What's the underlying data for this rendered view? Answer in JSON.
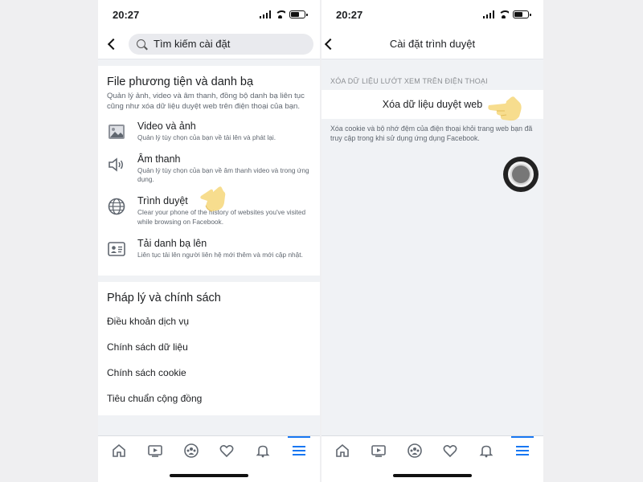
{
  "status": {
    "time": "20:27"
  },
  "left": {
    "search": {
      "placeholder": "Tìm kiếm cài đặt"
    },
    "media_section": {
      "title": "File phương tiện và danh bạ",
      "description": "Quản lý ảnh, video và âm thanh, đồng bộ danh bạ liên tục cũng như xóa dữ liệu duyệt web trên điện thoại của bạn.",
      "items": [
        {
          "title": "Video và ảnh",
          "desc": "Quản lý tùy chọn của bạn về tải lên và phát lại.",
          "icon": "photo-icon"
        },
        {
          "title": "Âm thanh",
          "desc": "Quản lý tùy chọn của bạn về âm thanh video và trong ứng dụng.",
          "icon": "speaker-icon"
        },
        {
          "title": "Trình duyệt",
          "desc": "Clear your phone of the history of websites you've visited while browsing on Facebook.",
          "icon": "globe-icon"
        },
        {
          "title": "Tải danh bạ lên",
          "desc": "Liên tục tải lên người liên hệ mới thêm và mới cập nhật.",
          "icon": "contact-card-icon"
        }
      ]
    },
    "legal_section": {
      "title": "Pháp lý và chính sách",
      "links": [
        "Điều khoản dịch vụ",
        "Chính sách dữ liệu",
        "Chính sách cookie",
        "Tiêu chuẩn cộng đồng"
      ]
    }
  },
  "right": {
    "title": "Cài đặt trình duyệt",
    "group_header": "XÓA DỮ LIỆU LƯỚT XEM TRÊN ĐIỆN THOẠI",
    "clear_button": "Xóa dữ liệu duyệt web",
    "footnote": "Xóa cookie và bộ nhớ đệm của điện thoại khỏi trang web bạn đã truy cập trong khi sử dụng ứng dụng Facebook."
  },
  "tabbar": {
    "icons": [
      "home-icon",
      "watch-icon",
      "groups-icon",
      "dating-icon",
      "bell-icon",
      "menu-icon"
    ],
    "active": "menu-icon"
  },
  "colors": {
    "accent": "#1877f2",
    "hand": "#f6d77a"
  }
}
